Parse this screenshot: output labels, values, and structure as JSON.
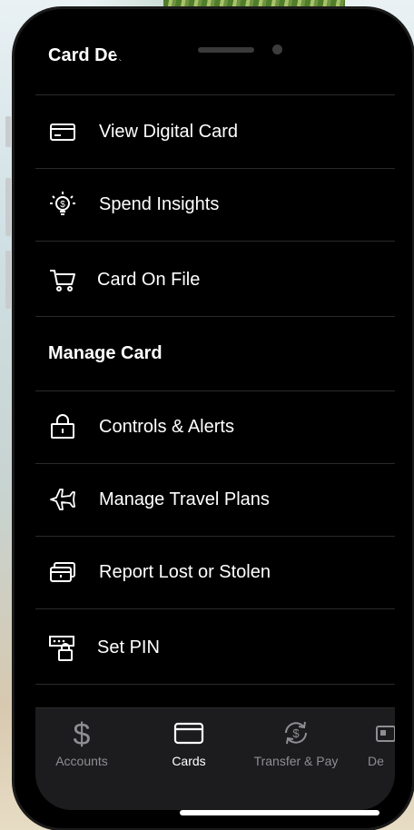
{
  "sections": {
    "card_details": "Card Details",
    "manage_card": "Manage Card"
  },
  "items": {
    "view_digital_card": "View Digital Card",
    "spend_insights": "Spend Insights",
    "card_on_file": "Card On File",
    "controls_alerts": "Controls & Alerts",
    "manage_travel_plans": "Manage Travel Plans",
    "report_lost_stolen": "Report Lost or Stolen",
    "set_pin": "Set PIN"
  },
  "tabbar": {
    "accounts": "Accounts",
    "cards": "Cards",
    "transfer_pay": "Transfer & Pay",
    "deposit": "De"
  },
  "colors": {
    "background": "#000000",
    "text": "#ffffff",
    "inactive": "#8e8e93",
    "tabbar": "#1c1c1e"
  }
}
